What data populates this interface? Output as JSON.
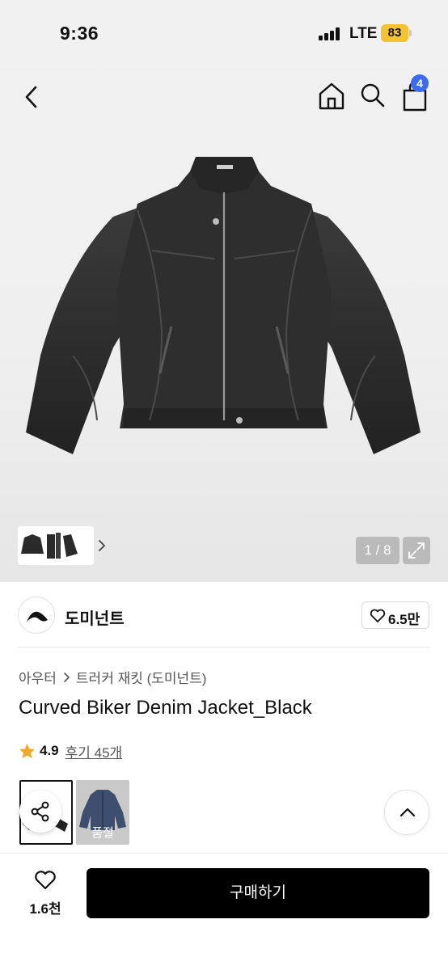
{
  "status_bar": {
    "time": "9:36",
    "network": "LTE",
    "battery": "83"
  },
  "header": {
    "cart_count": "4"
  },
  "gallery": {
    "counter": "1 / 8"
  },
  "brand": {
    "name": "도미넌트",
    "likes": "6.5만"
  },
  "breadcrumb": {
    "category": "아우터",
    "subcategory": "트러커 재킷 (도미넌트)"
  },
  "product": {
    "title": "Curved Biker Denim Jacket_Black",
    "rating": "4.9",
    "reviews": "후기 45개"
  },
  "options": {
    "sold_out_label": "품절"
  },
  "bottom_bar": {
    "wish_count": "1.6천",
    "buy_label": "구매하기"
  },
  "colors": {
    "accent_badge": "#3b6bf0",
    "star": "#f5a623",
    "battery": "#f5c330",
    "buy_button": "#000000"
  },
  "icons": [
    "chevron-left-icon",
    "home-icon",
    "search-icon",
    "shopping-bag-icon",
    "chevron-right-icon",
    "expand-icon",
    "heart-icon",
    "star-icon",
    "share-icon",
    "chevron-up-icon"
  ]
}
